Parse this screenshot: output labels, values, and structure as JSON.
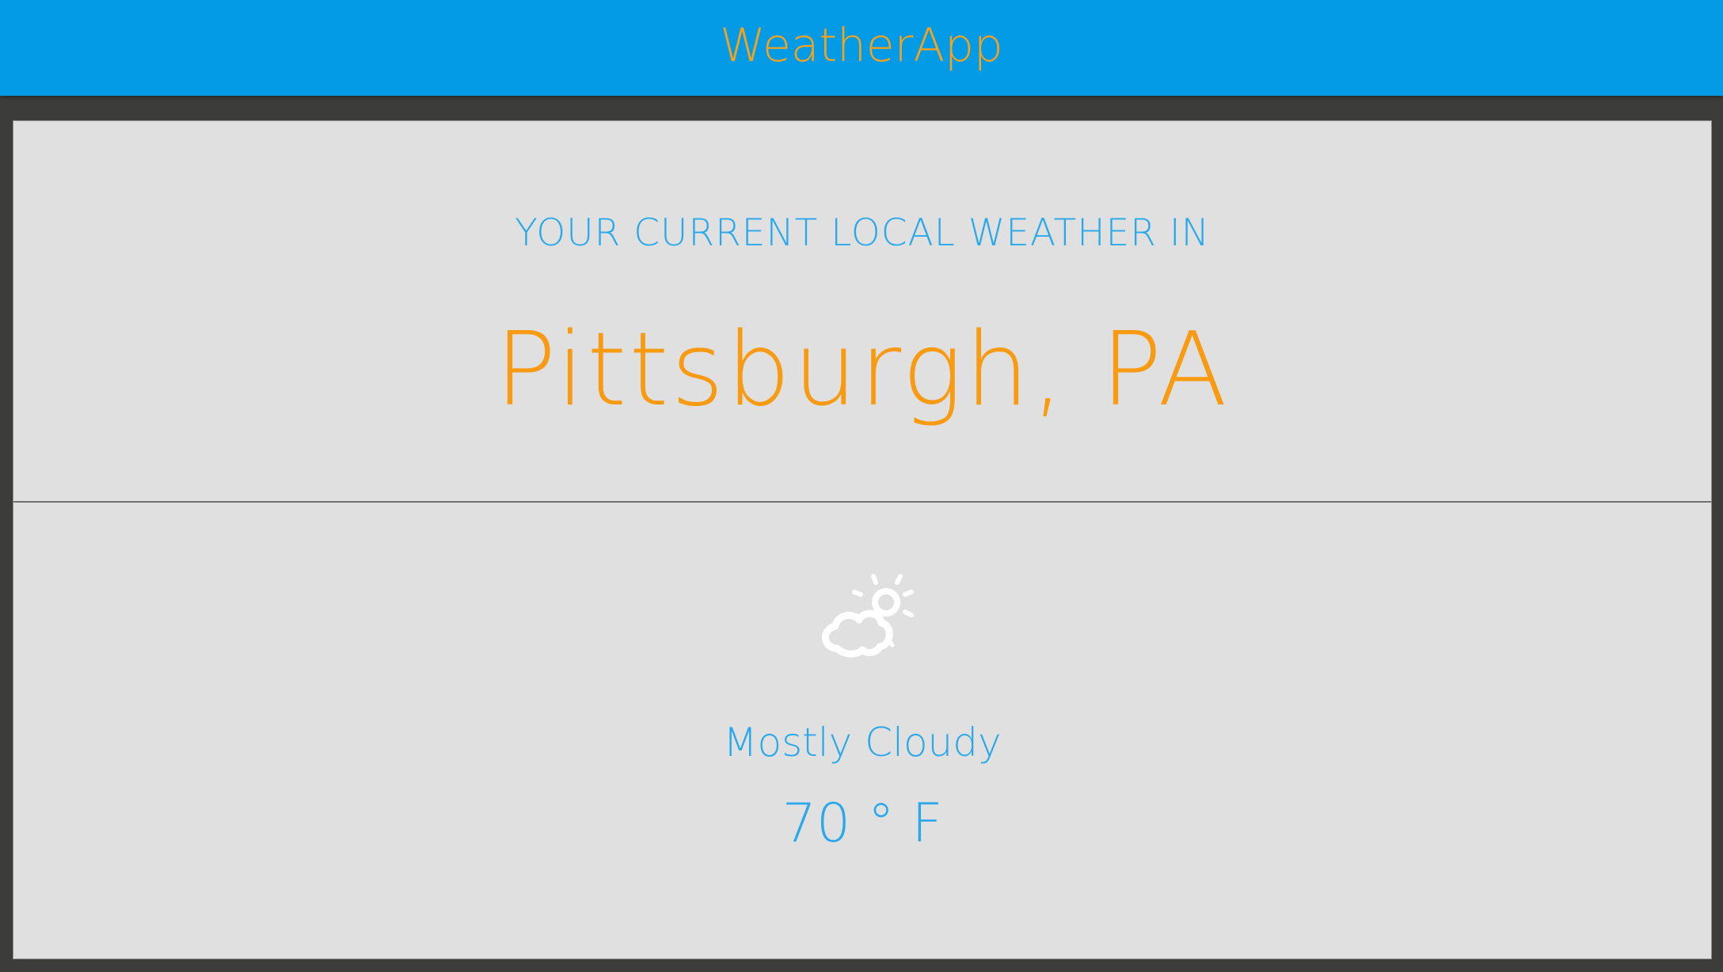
{
  "header": {
    "title": "WeatherApp",
    "background_color": "#039be5",
    "title_color": "#f7a21b"
  },
  "location": {
    "heading": "YOUR CURRENT LOCAL WEATHER IN",
    "city": "Pittsburgh, PA"
  },
  "weather": {
    "icon": "partly-cloudy-icon",
    "condition": "Mostly Cloudy",
    "temperature": "70 ° F"
  },
  "colors": {
    "accent_blue": "#29a9eb",
    "accent_orange": "#f89a12",
    "card_background": "#e0e0e0",
    "page_background": "#3c3d3b"
  }
}
